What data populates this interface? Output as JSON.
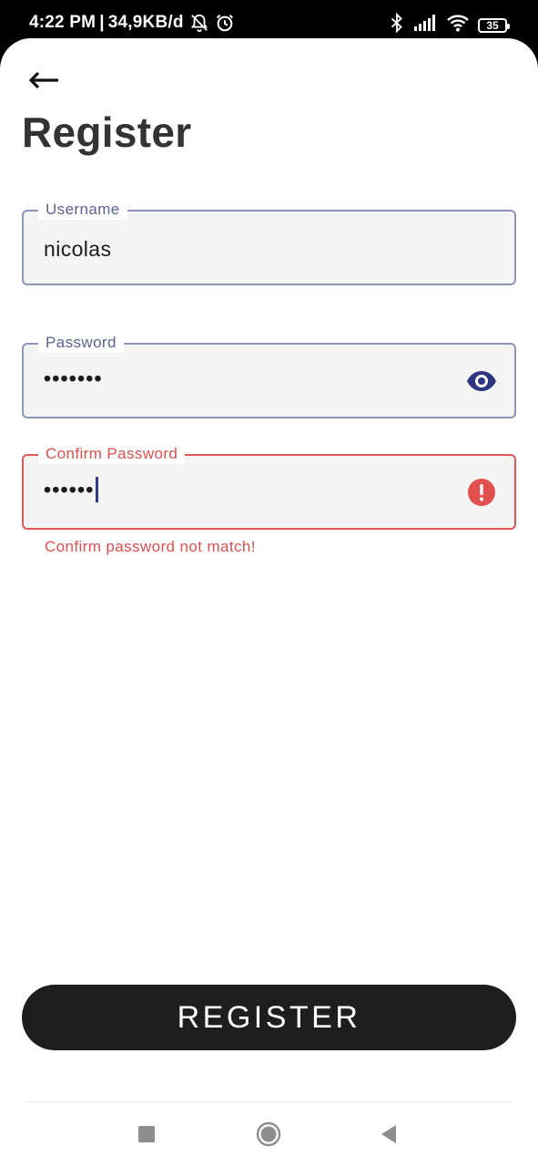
{
  "status_bar": {
    "time": "4:22 PM",
    "separator": "|",
    "network_speed": "34,9KB/d",
    "icons_left": [
      "bell-off-icon",
      "alarm-icon"
    ],
    "icons_right": [
      "bluetooth-icon",
      "signal-icon",
      "wifi-icon",
      "battery-icon"
    ],
    "battery_level": "35"
  },
  "header": {
    "back_icon": "arrow-left-icon",
    "title": "Register"
  },
  "form": {
    "username": {
      "label": "Username",
      "value": "nicolas"
    },
    "password": {
      "label": "Password",
      "value": "•••••••",
      "trailing_icon": "eye-icon"
    },
    "confirm_password": {
      "label": "Confirm Password",
      "value": "••••••",
      "trailing_icon": "error-icon",
      "error": "Confirm password not match!"
    }
  },
  "actions": {
    "register_label": "REGISTER"
  },
  "nav_bar": {
    "icons": [
      "recents-square-icon",
      "home-circle-icon",
      "back-triangle-icon"
    ]
  },
  "colors": {
    "outline": "#8f94ba",
    "label": "#5a6290",
    "error": "#de4f4f",
    "button_bg": "#1e1e1e",
    "field_bg": "#f4f4f5",
    "eye_icon": "#2d3580"
  }
}
